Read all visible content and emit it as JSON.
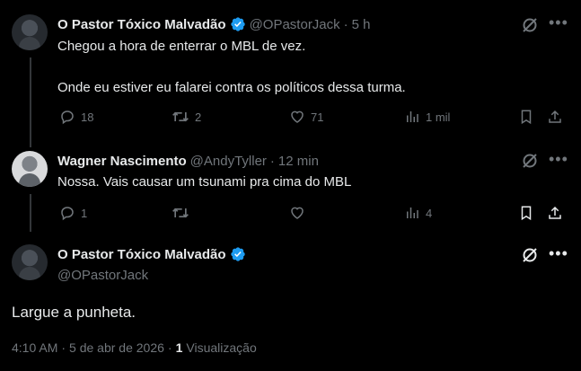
{
  "tweet1": {
    "name": "O Pastor Tóxico Malvadão",
    "handle": "@OPastorJack",
    "sep": "·",
    "time": "5 h",
    "line1": "Chegou a hora de enterrar o MBL de vez.",
    "line2": "Onde eu estiver eu falarei contra os políticos dessa turma.",
    "replies": "18",
    "reposts": "2",
    "likes": "71",
    "views": "1 mil"
  },
  "tweet2": {
    "name": "Wagner Nascimento",
    "handle": "@AndyTyller",
    "sep": "·",
    "time": "12 min",
    "text": "Nossa. Vais causar um tsunami pra cima do MBL",
    "replies": "1",
    "views": "4"
  },
  "main": {
    "name": "O Pastor Tóxico Malvadão",
    "handle": "@OPastorJack",
    "text": "Largue a punheta.",
    "time": "4:10 AM",
    "sep": "·",
    "date": "5 de abr de 2026",
    "views_count": "1",
    "views_label": "Visualização"
  },
  "icons": {
    "reply": "reply-icon",
    "repost": "repost-icon",
    "like": "like-icon",
    "views": "views-icon",
    "bookmark": "bookmark-icon",
    "share": "share-icon",
    "grok": "grok-icon",
    "more": "more-icon",
    "verified": "verified-badge-icon"
  },
  "colors": {
    "background": "#000000",
    "text": "#e7e9ea",
    "muted": "#71767b",
    "verified": "#1d9bf0"
  }
}
